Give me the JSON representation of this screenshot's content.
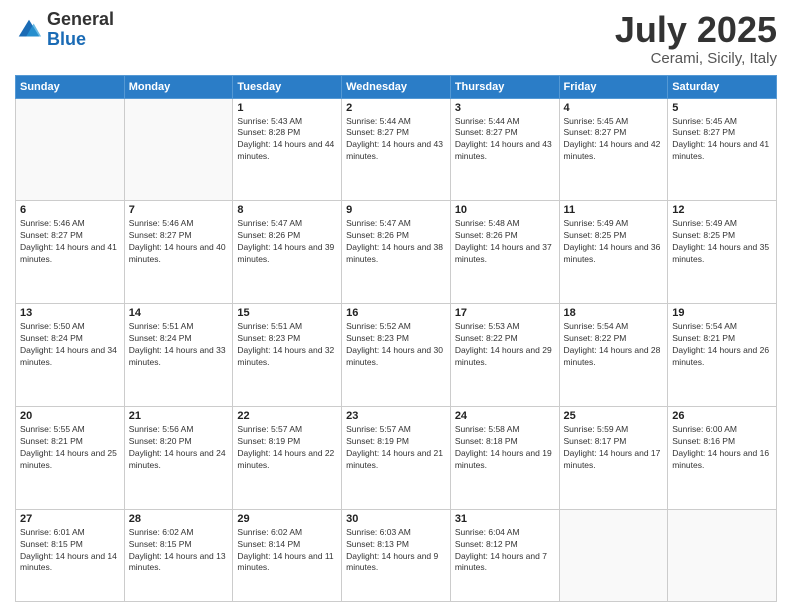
{
  "logo": {
    "general": "General",
    "blue": "Blue"
  },
  "header": {
    "month": "July 2025",
    "location": "Cerami, Sicily, Italy"
  },
  "days_of_week": [
    "Sunday",
    "Monday",
    "Tuesday",
    "Wednesday",
    "Thursday",
    "Friday",
    "Saturday"
  ],
  "weeks": [
    [
      {
        "day": "",
        "sunrise": "",
        "sunset": "",
        "daylight": ""
      },
      {
        "day": "",
        "sunrise": "",
        "sunset": "",
        "daylight": ""
      },
      {
        "day": "1",
        "sunrise": "Sunrise: 5:43 AM",
        "sunset": "Sunset: 8:28 PM",
        "daylight": "Daylight: 14 hours and 44 minutes."
      },
      {
        "day": "2",
        "sunrise": "Sunrise: 5:44 AM",
        "sunset": "Sunset: 8:27 PM",
        "daylight": "Daylight: 14 hours and 43 minutes."
      },
      {
        "day": "3",
        "sunrise": "Sunrise: 5:44 AM",
        "sunset": "Sunset: 8:27 PM",
        "daylight": "Daylight: 14 hours and 43 minutes."
      },
      {
        "day": "4",
        "sunrise": "Sunrise: 5:45 AM",
        "sunset": "Sunset: 8:27 PM",
        "daylight": "Daylight: 14 hours and 42 minutes."
      },
      {
        "day": "5",
        "sunrise": "Sunrise: 5:45 AM",
        "sunset": "Sunset: 8:27 PM",
        "daylight": "Daylight: 14 hours and 41 minutes."
      }
    ],
    [
      {
        "day": "6",
        "sunrise": "Sunrise: 5:46 AM",
        "sunset": "Sunset: 8:27 PM",
        "daylight": "Daylight: 14 hours and 41 minutes."
      },
      {
        "day": "7",
        "sunrise": "Sunrise: 5:46 AM",
        "sunset": "Sunset: 8:27 PM",
        "daylight": "Daylight: 14 hours and 40 minutes."
      },
      {
        "day": "8",
        "sunrise": "Sunrise: 5:47 AM",
        "sunset": "Sunset: 8:26 PM",
        "daylight": "Daylight: 14 hours and 39 minutes."
      },
      {
        "day": "9",
        "sunrise": "Sunrise: 5:47 AM",
        "sunset": "Sunset: 8:26 PM",
        "daylight": "Daylight: 14 hours and 38 minutes."
      },
      {
        "day": "10",
        "sunrise": "Sunrise: 5:48 AM",
        "sunset": "Sunset: 8:26 PM",
        "daylight": "Daylight: 14 hours and 37 minutes."
      },
      {
        "day": "11",
        "sunrise": "Sunrise: 5:49 AM",
        "sunset": "Sunset: 8:25 PM",
        "daylight": "Daylight: 14 hours and 36 minutes."
      },
      {
        "day": "12",
        "sunrise": "Sunrise: 5:49 AM",
        "sunset": "Sunset: 8:25 PM",
        "daylight": "Daylight: 14 hours and 35 minutes."
      }
    ],
    [
      {
        "day": "13",
        "sunrise": "Sunrise: 5:50 AM",
        "sunset": "Sunset: 8:24 PM",
        "daylight": "Daylight: 14 hours and 34 minutes."
      },
      {
        "day": "14",
        "sunrise": "Sunrise: 5:51 AM",
        "sunset": "Sunset: 8:24 PM",
        "daylight": "Daylight: 14 hours and 33 minutes."
      },
      {
        "day": "15",
        "sunrise": "Sunrise: 5:51 AM",
        "sunset": "Sunset: 8:23 PM",
        "daylight": "Daylight: 14 hours and 32 minutes."
      },
      {
        "day": "16",
        "sunrise": "Sunrise: 5:52 AM",
        "sunset": "Sunset: 8:23 PM",
        "daylight": "Daylight: 14 hours and 30 minutes."
      },
      {
        "day": "17",
        "sunrise": "Sunrise: 5:53 AM",
        "sunset": "Sunset: 8:22 PM",
        "daylight": "Daylight: 14 hours and 29 minutes."
      },
      {
        "day": "18",
        "sunrise": "Sunrise: 5:54 AM",
        "sunset": "Sunset: 8:22 PM",
        "daylight": "Daylight: 14 hours and 28 minutes."
      },
      {
        "day": "19",
        "sunrise": "Sunrise: 5:54 AM",
        "sunset": "Sunset: 8:21 PM",
        "daylight": "Daylight: 14 hours and 26 minutes."
      }
    ],
    [
      {
        "day": "20",
        "sunrise": "Sunrise: 5:55 AM",
        "sunset": "Sunset: 8:21 PM",
        "daylight": "Daylight: 14 hours and 25 minutes."
      },
      {
        "day": "21",
        "sunrise": "Sunrise: 5:56 AM",
        "sunset": "Sunset: 8:20 PM",
        "daylight": "Daylight: 14 hours and 24 minutes."
      },
      {
        "day": "22",
        "sunrise": "Sunrise: 5:57 AM",
        "sunset": "Sunset: 8:19 PM",
        "daylight": "Daylight: 14 hours and 22 minutes."
      },
      {
        "day": "23",
        "sunrise": "Sunrise: 5:57 AM",
        "sunset": "Sunset: 8:19 PM",
        "daylight": "Daylight: 14 hours and 21 minutes."
      },
      {
        "day": "24",
        "sunrise": "Sunrise: 5:58 AM",
        "sunset": "Sunset: 8:18 PM",
        "daylight": "Daylight: 14 hours and 19 minutes."
      },
      {
        "day": "25",
        "sunrise": "Sunrise: 5:59 AM",
        "sunset": "Sunset: 8:17 PM",
        "daylight": "Daylight: 14 hours and 17 minutes."
      },
      {
        "day": "26",
        "sunrise": "Sunrise: 6:00 AM",
        "sunset": "Sunset: 8:16 PM",
        "daylight": "Daylight: 14 hours and 16 minutes."
      }
    ],
    [
      {
        "day": "27",
        "sunrise": "Sunrise: 6:01 AM",
        "sunset": "Sunset: 8:15 PM",
        "daylight": "Daylight: 14 hours and 14 minutes."
      },
      {
        "day": "28",
        "sunrise": "Sunrise: 6:02 AM",
        "sunset": "Sunset: 8:15 PM",
        "daylight": "Daylight: 14 hours and 13 minutes."
      },
      {
        "day": "29",
        "sunrise": "Sunrise: 6:02 AM",
        "sunset": "Sunset: 8:14 PM",
        "daylight": "Daylight: 14 hours and 11 minutes."
      },
      {
        "day": "30",
        "sunrise": "Sunrise: 6:03 AM",
        "sunset": "Sunset: 8:13 PM",
        "daylight": "Daylight: 14 hours and 9 minutes."
      },
      {
        "day": "31",
        "sunrise": "Sunrise: 6:04 AM",
        "sunset": "Sunset: 8:12 PM",
        "daylight": "Daylight: 14 hours and 7 minutes."
      },
      {
        "day": "",
        "sunrise": "",
        "sunset": "",
        "daylight": ""
      },
      {
        "day": "",
        "sunrise": "",
        "sunset": "",
        "daylight": ""
      }
    ]
  ]
}
